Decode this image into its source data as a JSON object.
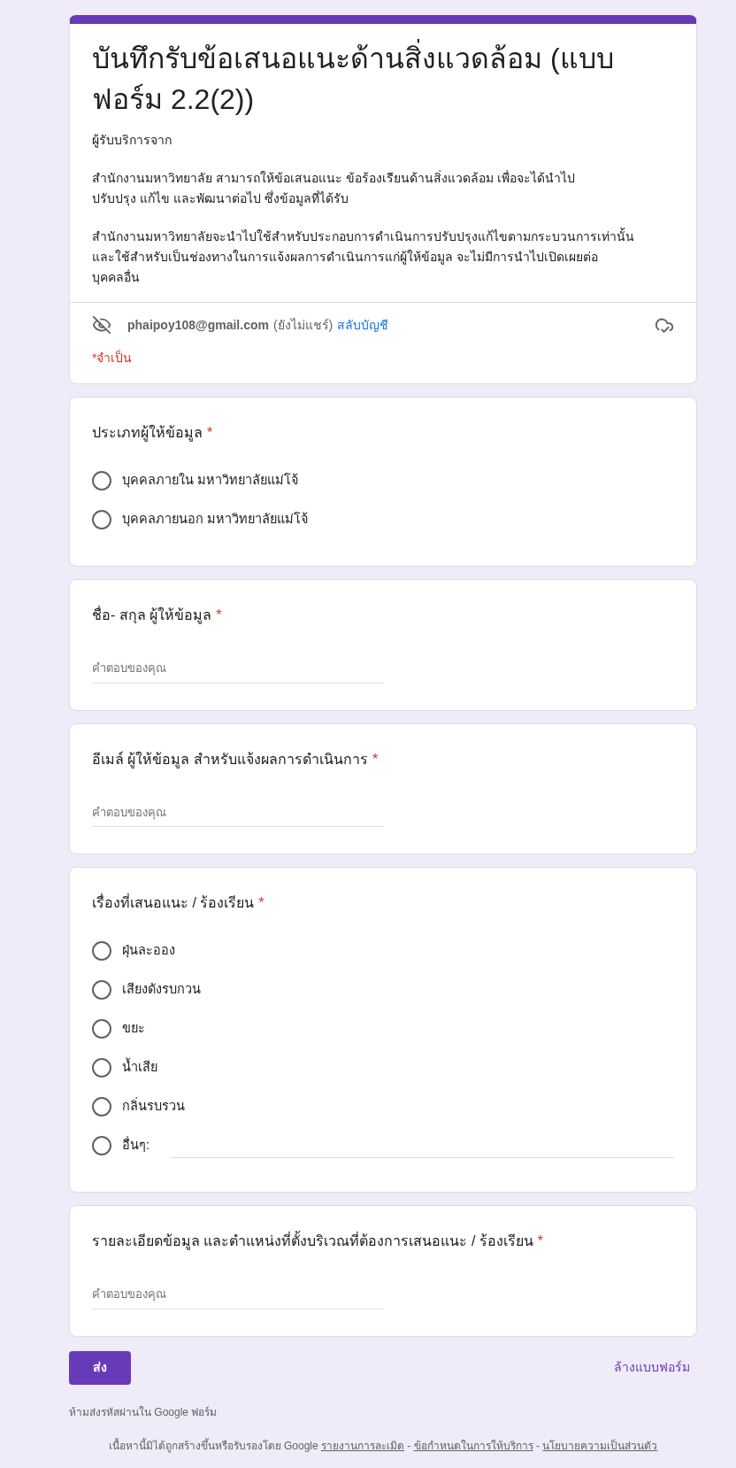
{
  "header": {
    "title": "บันทึกรับข้อเสนอแนะด้านสิ่งแวดล้อม (แบบฟอร์ม 2.2(2))",
    "description": [
      "ผู้รับบริการจาก",
      "สำนักงานมหาวิทยาลัย สามารถให้ข้อเสนอแนะ ข้อร้องเรียนด้านสิ่งแวดล้อม เพื่อจะได้นำไป\nปรับปรุง แก้ไข และพัฒนาต่อไป ซึ่งข้อมูลที่ได้รับ",
      "สำนักงานมหาวิทยาลัยจะนำไปใช้สำหรับประกอบการดำเนินการปรับปรุงแก้ไขตามกระบวนการเท่านั้น\nและใช้สำหรับเป็นช่องทางในการแจ้งผลการดำเนินการแก่ผู้ให้ข้อมูล จะไม่มีการนำไปเปิดเผยต่อ\nบุคคลอื่น"
    ],
    "account": {
      "email": "phaipoy108@gmail.com",
      "status": "(ยังไม่แชร์)",
      "switch_link": "สลับบัญชี"
    },
    "required_note": "*จำเป็น"
  },
  "questions": [
    {
      "kind": "radio",
      "title": "ประเภทผู้ให้ข้อมูล",
      "required_mark": "*",
      "options": [
        {
          "kind": "choice",
          "label": "บุคคลภายใน มหาวิทยาลัยแม่โจ้",
          "selected": false
        },
        {
          "kind": "choice",
          "label": "บุคคลภายนอก มหาวิทยาลัยแม่โจ้",
          "selected": false
        }
      ]
    },
    {
      "kind": "text",
      "title": "ชื่อ- สกุล ผู้ให้ข้อมูล",
      "required_mark": "*",
      "placeholder": "คำตอบของคุณ"
    },
    {
      "kind": "text",
      "title": "อีเมล์ ผู้ให้ข้อมูล สำหรับแจ้งผลการดำเนินการ",
      "required_mark": "*",
      "placeholder": "คำตอบของคุณ"
    },
    {
      "kind": "radio",
      "title": "เรื่องที่เสนอแนะ / ร้องเรียน",
      "required_mark": "*",
      "options": [
        {
          "kind": "choice",
          "label": "ฝุ่นละออง",
          "selected": false
        },
        {
          "kind": "choice",
          "label": "เสียงดังรบกวน",
          "selected": false
        },
        {
          "kind": "choice",
          "label": "ขยะ",
          "selected": false
        },
        {
          "kind": "choice",
          "label": "น้ำเสีย",
          "selected": false
        },
        {
          "kind": "choice",
          "label": "กลิ่นรบรวน",
          "selected": false
        },
        {
          "kind": "other",
          "label": "อื่นๆ:",
          "selected": false
        }
      ]
    },
    {
      "kind": "text",
      "title": "รายละเอียดข้อมูล และตำแหน่งที่ตั้งบริเวณที่ต้องการเสนอแนะ / ร้องเรียน",
      "required_mark": "*",
      "placeholder": "คำตอบของคุณ"
    }
  ],
  "actions": {
    "submit": "ส่ง",
    "clear": "ล้างแบบฟอร์ม"
  },
  "footer": {
    "warning": "ห้ามส่งรหัสผ่านใน Google ฟอร์ม",
    "disclaimer": "เนื้อหานี้มิได้ถูกสร้างขึ้นหรือรับรองโดย Google",
    "separator": "-",
    "links": [
      "รายงานการละเมิด",
      "ข้อกำหนดในการให้บริการ",
      "นโยบายความเป็นส่วนตัว"
    ]
  }
}
